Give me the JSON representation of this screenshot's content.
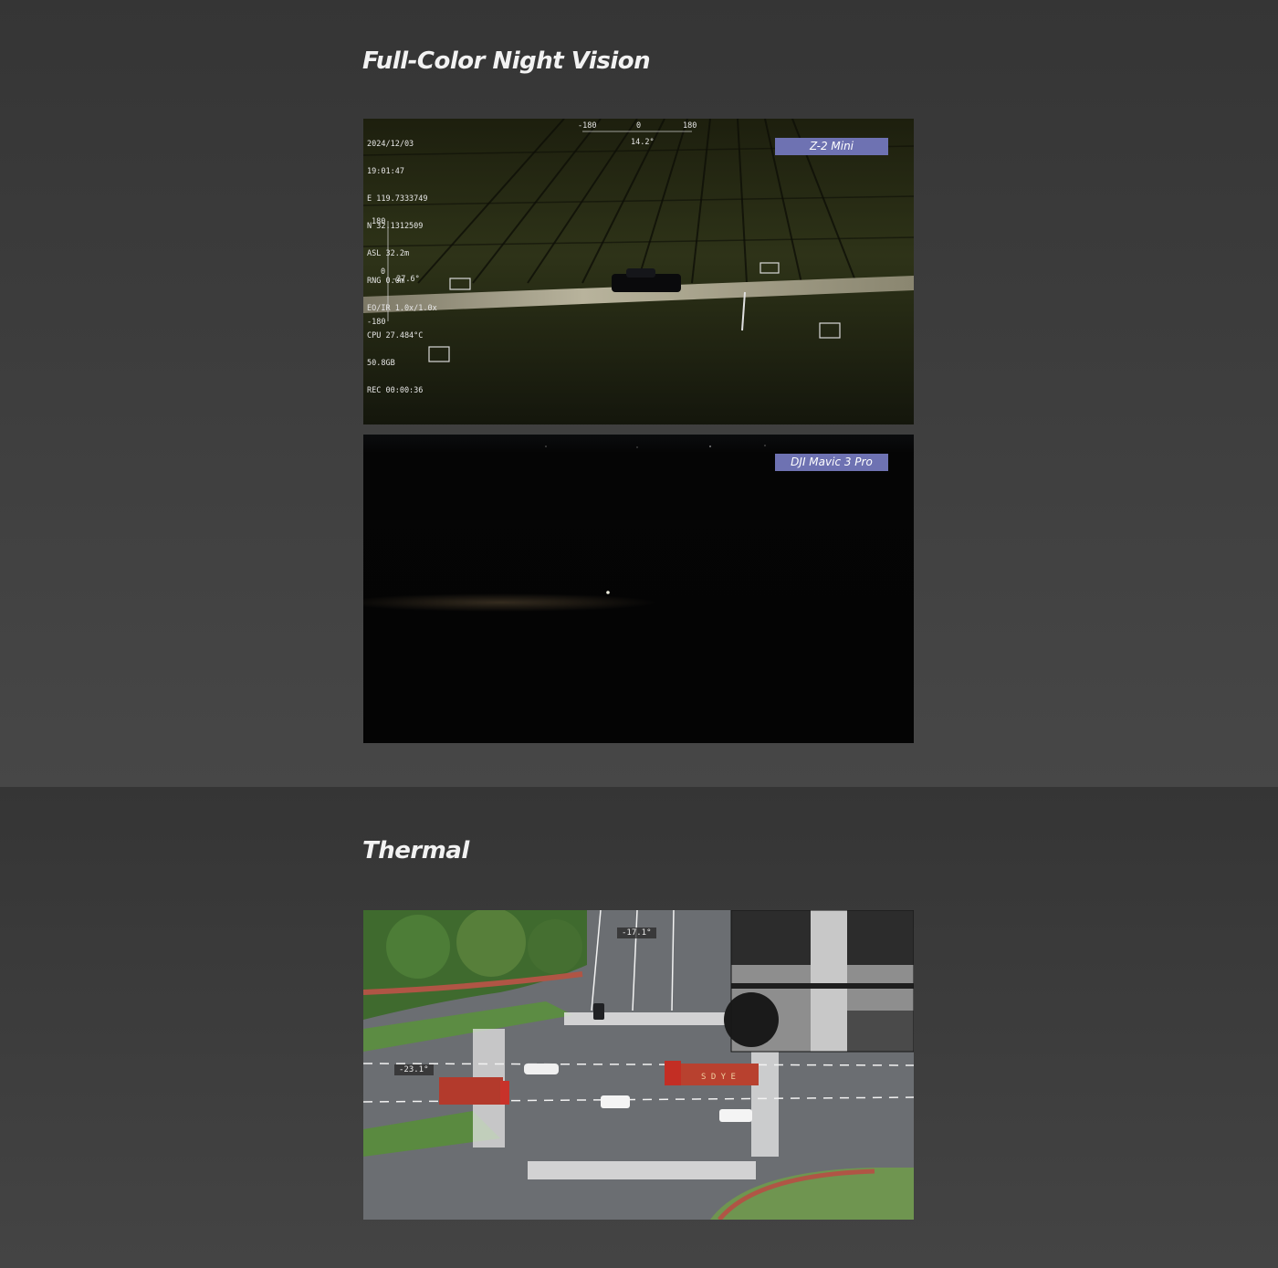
{
  "sections": {
    "night": {
      "title": "Full-Color Night Vision"
    },
    "thermal": {
      "title": "Thermal"
    }
  },
  "night_frame_top": {
    "badge": "Z-2 Mini",
    "osd_lines": [
      "2024/12/03",
      "19:01:47",
      "E 119.7333749",
      "N 32.1312509",
      "ASL 32.2m",
      "RNG 0.0m",
      "EO/IR 1.0x/1.0x",
      "CPU 27.484°C",
      "50.8GB",
      "REC 00:00:36"
    ],
    "yaw_ticks": [
      "-180",
      "0",
      "180"
    ],
    "yaw_value": "14.2°",
    "pitch_ticks": [
      "180",
      "0",
      "-180"
    ],
    "pitch_value": "-27.6°"
  },
  "night_frame_bottom": {
    "badge": "DJI Mavic 3 Pro"
  },
  "thermal_frame": {
    "yaw_value": "-17.1°",
    "pitch_value": "-23.1°",
    "truck_text": "S D Y E"
  },
  "colors": {
    "badge": "#6e72b2",
    "title": "#f2f2f2",
    "background": "#3a3a3a"
  }
}
